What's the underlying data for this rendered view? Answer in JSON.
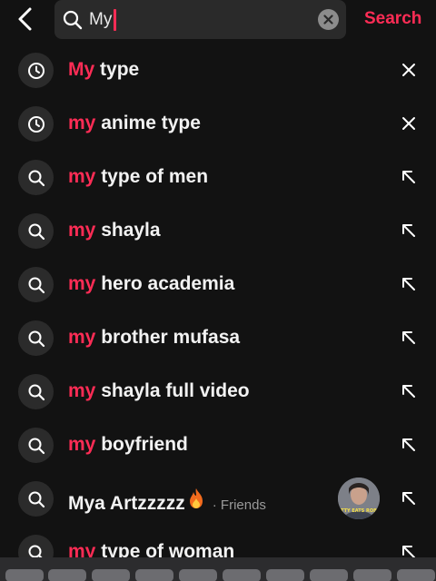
{
  "topbar": {
    "search_query": "My",
    "search_button_label": "Search"
  },
  "suggestions": [
    {
      "highlight": "My",
      "rest": " type",
      "kind": "history",
      "action": "remove"
    },
    {
      "highlight": "my",
      "rest": " anime type",
      "kind": "history",
      "action": "remove"
    },
    {
      "highlight": "my",
      "rest": " type of men",
      "kind": "search",
      "action": "fill"
    },
    {
      "highlight": "my",
      "rest": " shayla",
      "kind": "search",
      "action": "fill"
    },
    {
      "highlight": "my",
      "rest": " hero academia",
      "kind": "search",
      "action": "fill"
    },
    {
      "highlight": "my",
      "rest": " brother mufasa",
      "kind": "search",
      "action": "fill"
    },
    {
      "highlight": "my",
      "rest": " shayla full video",
      "kind": "search",
      "action": "fill"
    },
    {
      "highlight": "my",
      "rest": " boyfriend",
      "kind": "search",
      "action": "fill"
    },
    {
      "highlight": "",
      "rest": "Mya Artzzzzz",
      "kind": "user",
      "action": "fill",
      "badge": "· Friends",
      "has_fire_emoji": true,
      "avatar_caption": "TTY EATS ROB"
    },
    {
      "highlight": "my",
      "rest": " type of woman",
      "kind": "search",
      "action": "fill"
    }
  ],
  "colors": {
    "accent": "#fe2c55",
    "background": "#121212",
    "search_field": "#2a2a2a"
  },
  "icons": {
    "back": "chevron-left-icon",
    "search": "magnifier-icon",
    "clear": "clear-x-icon",
    "history": "clock-icon",
    "remove": "close-icon",
    "fill": "arrow-up-left-icon"
  }
}
